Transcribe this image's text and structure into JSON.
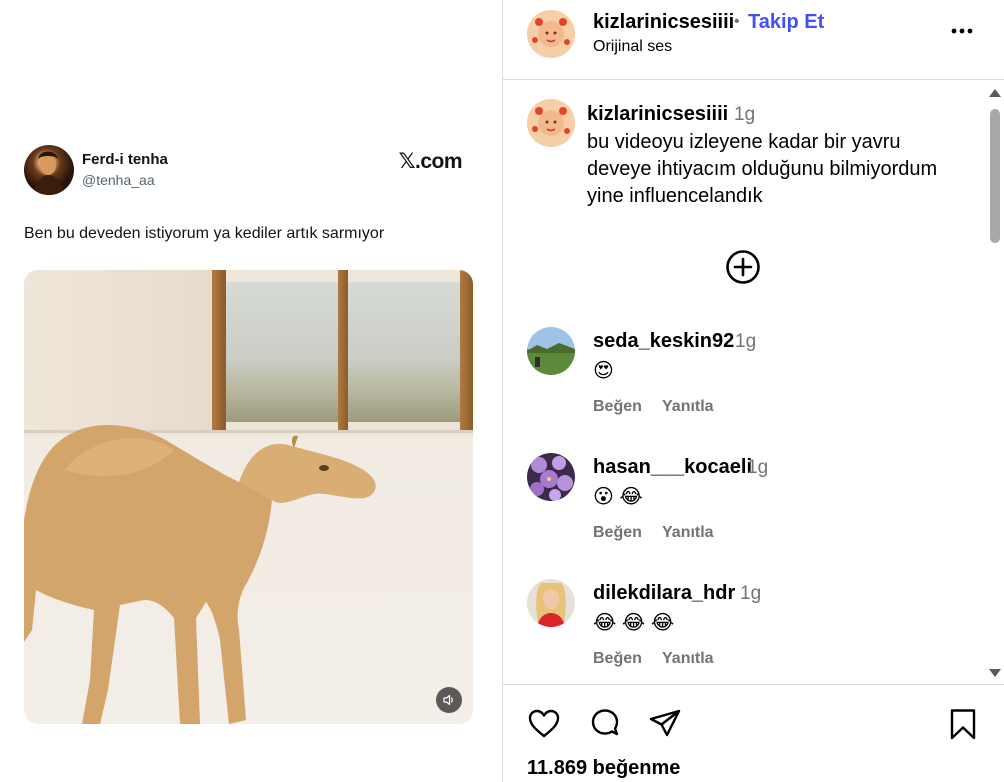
{
  "tweet": {
    "author_name": "Ferd-i tenha",
    "author_handle": "@tenha_aa",
    "site": "𝕏.com",
    "text": "Ben bu deveden istiyorum ya kediler artık sarmıyor"
  },
  "post": {
    "username": "kizlarinicsesiiii",
    "separator": "•",
    "follow_label": "Takip Et",
    "audio_label": "Orijinal ses",
    "caption_time": "1g",
    "caption_text": "bu videoyu izleyene kadar bir yavru deveye ihtiyacım olduğunu bilmiyordum yine influencelandık",
    "likes_text": "11.869 beğenme"
  },
  "comments": [
    {
      "user": "seda_keskin92",
      "time": "1g",
      "text": "😍",
      "like_label": "Beğen",
      "reply_label": "Yanıtla"
    },
    {
      "user": "hasan___kocaeli",
      "time": "1g",
      "text": "😮 😂",
      "like_label": "Beğen",
      "reply_label": "Yanıtla"
    },
    {
      "user": "dilekdilara_hdr",
      "time": "1g",
      "text": "😂 😂 😂",
      "like_label": "Beğen",
      "reply_label": "Yanıtla"
    }
  ],
  "icons": {
    "more": "more-horizontal-icon",
    "load_more": "plus-circle-icon",
    "like": "heart-icon",
    "comment": "comment-bubble-icon",
    "share": "paper-plane-icon",
    "save": "bookmark-icon",
    "sound": "speaker-icon"
  },
  "colors": {
    "follow": "#4150f7",
    "muted": "#737373",
    "divider": "#dbdbdb"
  }
}
